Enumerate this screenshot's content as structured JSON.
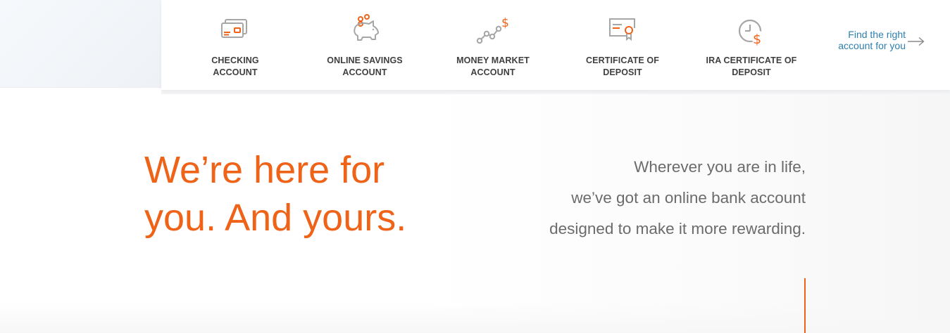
{
  "colors": {
    "accent_orange": "#ee6318",
    "icon_gray": "#a6a6a6",
    "label_text": "#3f3f3f",
    "link_blue": "#2e7fae",
    "body_text": "#6b6b6b"
  },
  "nav": {
    "items": [
      {
        "label": "CHECKING ACCOUNT",
        "icon": "checking-card-icon"
      },
      {
        "label": "ONLINE SAVINGS ACCOUNT",
        "icon": "piggy-bank-icon"
      },
      {
        "label": "MONEY MARKET ACCOUNT",
        "icon": "market-trend-icon"
      },
      {
        "label": "CERTIFICATE OF DEPOSIT",
        "icon": "certificate-icon"
      },
      {
        "label": "IRA CERTIFICATE OF DEPOSIT",
        "icon": "clock-dollar-icon"
      }
    ],
    "find_link": {
      "line1": "Find the right",
      "line2": "account for you",
      "icon": "arrow-right-icon"
    }
  },
  "hero": {
    "headline_line1": "We’re here for",
    "headline_line2": "you. And yours.",
    "subtext_line1": "Wherever you are in life,",
    "subtext_line2": "we’ve got an online bank account",
    "subtext_line3": "designed to make it more rewarding."
  }
}
